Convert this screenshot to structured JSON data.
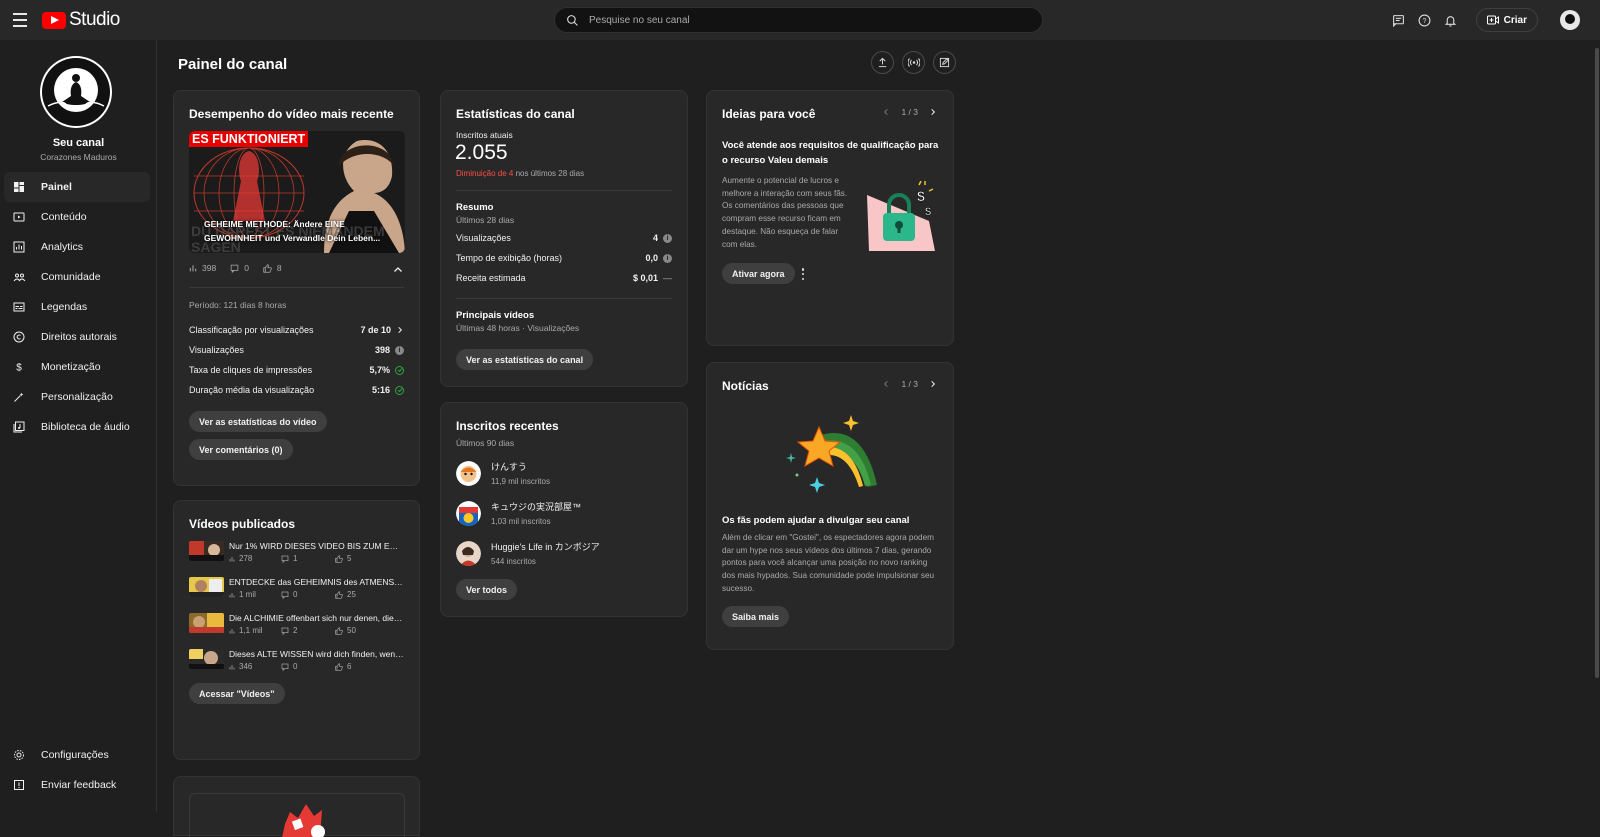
{
  "app": {
    "logo_text": "Studio"
  },
  "search": {
    "placeholder": "Pesquise no seu canal"
  },
  "topbar": {
    "create_label": "Criar"
  },
  "channel": {
    "name": "Seu canal",
    "handle": "Corazones Maduros"
  },
  "sidebar": {
    "items": [
      {
        "label": "Painel",
        "icon": "dashboard-icon",
        "active": true
      },
      {
        "label": "Conteúdo",
        "icon": "content-icon"
      },
      {
        "label": "Analytics",
        "icon": "analytics-icon"
      },
      {
        "label": "Comunidade",
        "icon": "community-icon"
      },
      {
        "label": "Legendas",
        "icon": "subtitles-icon"
      },
      {
        "label": "Direitos autorais",
        "icon": "copyright-icon"
      },
      {
        "label": "Monetização",
        "icon": "dollar-icon"
      },
      {
        "label": "Personalização",
        "icon": "magic-wand-icon"
      },
      {
        "label": "Biblioteca de áudio",
        "icon": "audio-library-icon"
      }
    ],
    "bottom": [
      {
        "label": "Configurações",
        "icon": "gear-icon"
      },
      {
        "label": "Enviar feedback",
        "icon": "feedback-icon"
      }
    ]
  },
  "page": {
    "title": "Painel do canal"
  },
  "latest_video": {
    "title": "Desempenho do vídeo mais recente",
    "thumb_banner": "ES FUNKTIONIERT",
    "thumb_overlay": "GEHEIME METHODE: Ändere EINE GEWOHNHEIT und Verwandle Dein Leben...",
    "thumb_bg_text": "DU DARFST ES NIEMANDEM SAGEN",
    "views": "398",
    "comments": "0",
    "likes": "8",
    "period": "Período: 121 dias 8 horas",
    "rows": [
      {
        "label": "Classificação por visualizações",
        "value": "7 de 10"
      },
      {
        "label": "Visualizações",
        "value": "398"
      },
      {
        "label": "Taxa de cliques de impressões",
        "value": "5,7%"
      },
      {
        "label": "Duração média da visualização",
        "value": "5:16"
      }
    ],
    "btn_stats": "Ver as estatísticas do vídeo",
    "btn_comments": "Ver comentários (0)"
  },
  "published": {
    "title": "Vídeos publicados",
    "videos": [
      {
        "title": "Nur 1% WIRD DIESES VIDEO BIS ZUM ENDE SEHEN...",
        "views": "278",
        "comments": "1",
        "likes": "5"
      },
      {
        "title": "ENTDECKE das GEHEIMNIS des ATMENS, das ...",
        "views": "1 mil",
        "comments": "0",
        "likes": "25"
      },
      {
        "title": "Die ALCHIMIE offenbart sich nur denen, die BE...",
        "views": "1,1 mil",
        "comments": "2",
        "likes": "50"
      },
      {
        "title": "Dieses ALTE WISSEN wird dich finden, wenn du...",
        "views": "346",
        "comments": "0",
        "likes": "6"
      }
    ],
    "btn": "Acessar \"Vídeos\""
  },
  "stats": {
    "title": "Estatísticas do canal",
    "subs_label": "Inscritos atuais",
    "subs_value": "2.055",
    "change_red": "Diminuição de 4",
    "change_rest": " nos últimos 28 dias",
    "summary_title": "Resumo",
    "summary_sub": "Últimos 28 dias",
    "rows": [
      {
        "label": "Visualizações",
        "value": "4"
      },
      {
        "label": "Tempo de exibição (horas)",
        "value": "0,0"
      },
      {
        "label": "Receita estimada",
        "value": "$ 0,01",
        "suffix": "—"
      }
    ],
    "top_title": "Principais vídeos",
    "top_sub": "Últimas 48 horas · Visualizações",
    "btn": "Ver as estatísticas do canal"
  },
  "recent_subs": {
    "title": "Inscritos recentes",
    "sub": "Últimos 90 dias",
    "items": [
      {
        "name": "けんすう",
        "count": "11,9 mil inscritos"
      },
      {
        "name": "キュウジの実況部屋™",
        "count": "1,03 mil inscritos"
      },
      {
        "name": "Huggie's Life in カンボジア",
        "count": "544 inscritos"
      }
    ],
    "btn": "Ver todos"
  },
  "ideas": {
    "title": "Ideias para você",
    "pager": "1 / 3",
    "heading": "Você atende aos requisitos de qualificação para o recurso Valeu demais",
    "body": "Aumente o potencial de lucros e melhore a interação com seus fãs. Os comentários das pessoas que compram esse recurso ficam em destaque. Não esqueça de falar com elas.",
    "btn": "Ativar agora"
  },
  "news": {
    "title": "Notícias",
    "pager": "1 / 3",
    "heading": "Os fãs podem ajudar a divulgar seu canal",
    "body": "Além de clicar em \"Gostei\", os espectadores agora podem dar um hype nos seus vídeos dos últimos 7 dias, gerando pontos para você alcançar uma posição no novo ranking dos mais hypados. Sua comunidade pode impulsionar seu sucesso.",
    "btn": "Saiba mais"
  }
}
